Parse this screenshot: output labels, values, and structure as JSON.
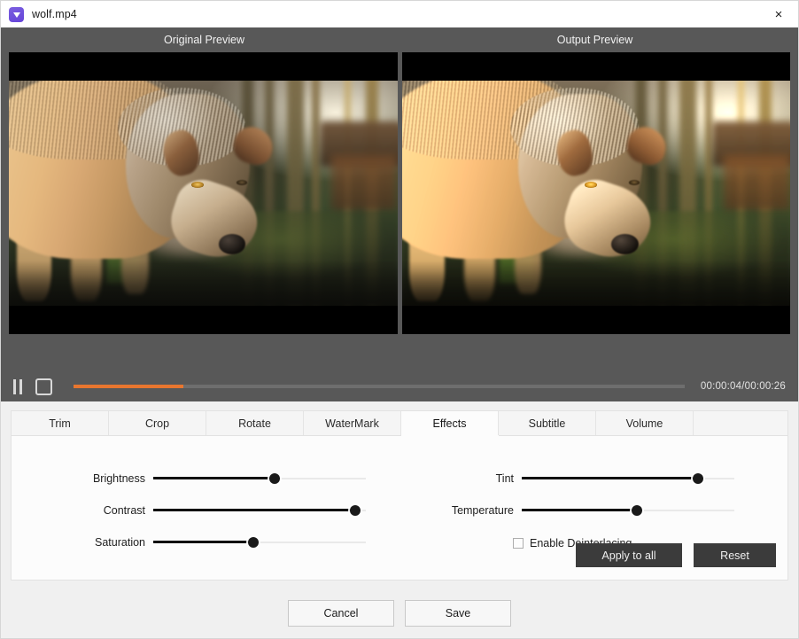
{
  "window": {
    "title": "wolf.mp4",
    "app_icon": "video-file-icon",
    "close_label": "×"
  },
  "preview": {
    "original_label": "Original Preview",
    "output_label": "Output Preview"
  },
  "transport": {
    "pause_icon": "pause-icon",
    "stop_icon": "stop-icon",
    "time": "00:00:04/00:00:26",
    "progress_percent": 18,
    "progress_color": "#e8762f"
  },
  "tabs": [
    {
      "label": "Trim",
      "active": false
    },
    {
      "label": "Crop",
      "active": false
    },
    {
      "label": "Rotate",
      "active": false
    },
    {
      "label": "WaterMark",
      "active": false
    },
    {
      "label": "Effects",
      "active": true
    },
    {
      "label": "Subtitle",
      "active": false
    },
    {
      "label": "Volume",
      "active": false
    }
  ],
  "effects": {
    "left_sliders": [
      {
        "label": "Brightness",
        "value": 57
      },
      {
        "label": "Contrast",
        "value": 95
      },
      {
        "label": "Saturation",
        "value": 47
      }
    ],
    "right_sliders": [
      {
        "label": "Tint",
        "value": 83
      },
      {
        "label": "Temperature",
        "value": 54
      }
    ],
    "deinterlacing": {
      "label": "Enable Deinterlacing",
      "checked": false
    },
    "apply_label": "Apply to all",
    "reset_label": "Reset"
  },
  "footer": {
    "cancel_label": "Cancel",
    "save_label": "Save"
  }
}
